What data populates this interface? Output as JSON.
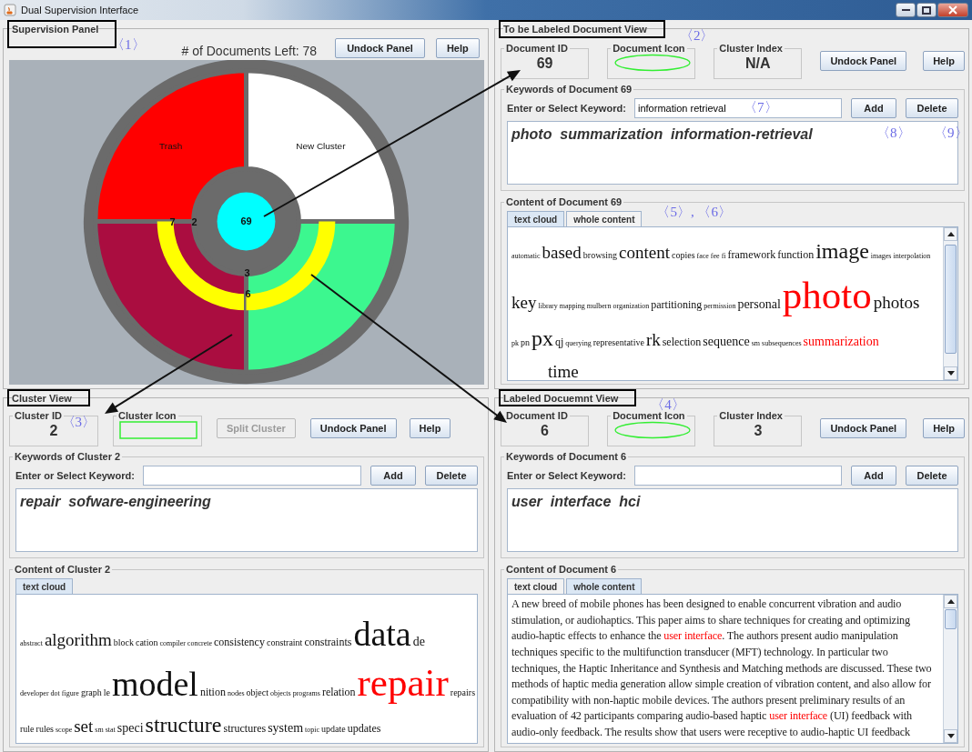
{
  "window": {
    "title": "Dual Supervision Interface"
  },
  "supervision_panel": {
    "title": "Supervision Panel",
    "marker": "〈1〉",
    "documents_left": "# of Documents Left: 78",
    "buttons": [
      "Undock Panel",
      "Help"
    ],
    "wheel": {
      "center_label": "69",
      "ring_labels": [
        "7",
        "2",
        "3",
        "6"
      ],
      "sectors": [
        {
          "label": "Trash",
          "color": "#ff0000"
        },
        {
          "label": "New Cluster",
          "color": "#ffffff"
        },
        {
          "color": "#aa0d40"
        },
        {
          "color": "#3cf78f"
        }
      ]
    }
  },
  "document_view": {
    "title": "To be Labeled Document View",
    "title_marker": "〈2〉",
    "info_boxes": [
      {
        "label": "Document ID",
        "kind": "value",
        "value": "69"
      },
      {
        "label": "Document Icon",
        "kind": "ellipse"
      },
      {
        "label": "Cluster Index",
        "kind": "value",
        "value": "N/A"
      }
    ],
    "buttons": [
      {
        "label": "Undock Panel",
        "disabled": false
      },
      {
        "label": "Help",
        "disabled": false
      }
    ],
    "keywords": {
      "title": "Keywords of Document 69",
      "prompt": "Enter or Select Keyword:",
      "input_value": "information retrieval",
      "input_marker": "〈7〉",
      "add": "Add",
      "delete": "Delete",
      "text": "photo  summarization  information-retrieval",
      "markers": [
        "〈8〉",
        "〈9〉"
      ]
    },
    "content": {
      "title": "Content of Document 69",
      "tabs_marker": "〈5〉, 〈6〉",
      "kind": "cloud",
      "scrollbar": true,
      "tabs": [
        {
          "label": "text cloud",
          "selected": true
        },
        {
          "label": "whole content",
          "selected": false
        }
      ],
      "lines": [
        [
          {
            "text": "automatic",
            "kind": "tiny",
            "highlighted": false
          },
          {
            "text": "based",
            "kind": "large",
            "highlighted": false
          },
          {
            "text": "browsing",
            "kind": "small",
            "highlighted": false
          },
          {
            "text": "content",
            "kind": "large",
            "highlighted": false
          },
          {
            "text": "copies",
            "kind": "small",
            "highlighted": false
          },
          {
            "text": "face",
            "kind": "tiny",
            "highlighted": false
          },
          {
            "text": "fee",
            "kind": "tiny",
            "highlighted": false
          },
          {
            "text": "fi",
            "kind": "tiny",
            "highlighted": false
          },
          {
            "text": "framework",
            "kind": "normal",
            "highlighted": false
          },
          {
            "text": "function",
            "kind": "normal",
            "highlighted": false
          },
          {
            "text": "image",
            "kind": "xlarge",
            "highlighted": false
          },
          {
            "text": "images",
            "kind": "tiny",
            "highlighted": false
          },
          {
            "text": "interpolation",
            "kind": "tiny",
            "highlighted": false
          }
        ],
        [
          {
            "text": "key",
            "kind": "large",
            "highlighted": false
          },
          {
            "text": "library",
            "kind": "tiny",
            "highlighted": false
          },
          {
            "text": "mapping",
            "kind": "tiny",
            "highlighted": false
          },
          {
            "text": "mulbern",
            "kind": "tiny",
            "highlighted": false
          },
          {
            "text": "organization",
            "kind": "tiny",
            "highlighted": false
          },
          {
            "text": "partitioning",
            "kind": "normal",
            "highlighted": false
          },
          {
            "text": "permission",
            "kind": "tiny",
            "highlighted": false
          },
          {
            "text": "personal",
            "kind": "medium",
            "highlighted": false
          },
          {
            "text": "photo",
            "kind": "giant",
            "highlighted": true
          },
          {
            "text": "photos",
            "kind": "large",
            "highlighted": false
          }
        ],
        [
          {
            "text": "pk",
            "kind": "tiny",
            "highlighted": false
          },
          {
            "text": "pn",
            "kind": "small",
            "highlighted": false
          },
          {
            "text": "px",
            "kind": "xlarge",
            "highlighted": false
          },
          {
            "text": "qj",
            "kind": "normal",
            "highlighted": false
          },
          {
            "text": "querying",
            "kind": "tiny",
            "highlighted": false
          },
          {
            "text": "representative",
            "kind": "small",
            "highlighted": false
          },
          {
            "text": "rk",
            "kind": "large",
            "highlighted": false
          },
          {
            "text": "selection",
            "kind": "normal",
            "highlighted": false
          },
          {
            "text": "sequence",
            "kind": "medium",
            "highlighted": false
          },
          {
            "text": "sm",
            "kind": "tiny",
            "highlighted": false
          },
          {
            "text": "subsequences",
            "kind": "tiny",
            "highlighted": false
          },
          {
            "text": "summarization",
            "kind": "medium",
            "highlighted": true
          }
        ],
        [
          {
            "text": "time",
            "kind": "large",
            "highlighted": false
          }
        ]
      ]
    }
  },
  "cluster_view": {
    "title": "Cluster View",
    "info_boxes": [
      {
        "label": "Cluster ID",
        "kind": "value",
        "value": "2",
        "marker": "〈3〉"
      },
      {
        "label": "Cluster Icon",
        "kind": "rect"
      }
    ],
    "buttons": [
      {
        "label": "Split Cluster",
        "disabled": true
      },
      {
        "label": "Undock Panel",
        "disabled": false
      },
      {
        "label": "Help",
        "disabled": false
      }
    ],
    "keywords": {
      "title": "Keywords of Cluster 2",
      "prompt": "Enter or Select Keyword:",
      "add": "Add",
      "delete": "Delete",
      "text": "repair  sofware-engineering"
    },
    "content": {
      "title": "Content of Cluster 2",
      "kind": "cloud",
      "scrollbar": false,
      "tabs": [
        {
          "label": "text cloud",
          "selected": true
        }
      ],
      "lines": [
        [
          {
            "text": "abstract",
            "kind": "tiny",
            "highlighted": false
          },
          {
            "text": "algorithm",
            "kind": "large",
            "highlighted": false
          },
          {
            "text": "block",
            "kind": "small",
            "highlighted": false
          },
          {
            "text": "cation",
            "kind": "small",
            "highlighted": false
          },
          {
            "text": "compiler",
            "kind": "tiny",
            "highlighted": false
          },
          {
            "text": "concrete",
            "kind": "tiny",
            "highlighted": false
          },
          {
            "text": "consistency",
            "kind": "normal",
            "highlighted": false
          },
          {
            "text": "constraint",
            "kind": "small",
            "highlighted": false
          },
          {
            "text": "constraints",
            "kind": "normal",
            "highlighted": false
          },
          {
            "text": "data",
            "kind": "huge",
            "highlighted": false
          },
          {
            "text": "de",
            "kind": "medium",
            "highlighted": false
          }
        ],
        [
          {
            "text": "developer",
            "kind": "tiny",
            "highlighted": false
          },
          {
            "text": "dot",
            "kind": "tiny",
            "highlighted": false
          },
          {
            "text": "figure",
            "kind": "tiny",
            "highlighted": false
          },
          {
            "text": "graph",
            "kind": "small",
            "highlighted": false
          },
          {
            "text": "le",
            "kind": "small",
            "highlighted": false
          },
          {
            "text": "model",
            "kind": "huge",
            "highlighted": false
          },
          {
            "text": "nition",
            "kind": "normal",
            "highlighted": false
          },
          {
            "text": "nodes",
            "kind": "tiny",
            "highlighted": false
          },
          {
            "text": "object",
            "kind": "small",
            "highlighted": false
          },
          {
            "text": "objects",
            "kind": "tiny",
            "highlighted": false
          },
          {
            "text": "programs",
            "kind": "tiny",
            "highlighted": false
          },
          {
            "text": "relation",
            "kind": "normal",
            "highlighted": false
          },
          {
            "text": "repair",
            "kind": "giant",
            "highlighted": true
          },
          {
            "text": "repairs",
            "kind": "small",
            "highlighted": false
          }
        ],
        [
          {
            "text": "rule",
            "kind": "small",
            "highlighted": false
          },
          {
            "text": "rules",
            "kind": "small",
            "highlighted": false
          },
          {
            "text": "scope",
            "kind": "tiny",
            "highlighted": false
          },
          {
            "text": "set",
            "kind": "large",
            "highlighted": false
          },
          {
            "text": "sm",
            "kind": "tiny",
            "highlighted": false
          },
          {
            "text": "stat",
            "kind": "tiny",
            "highlighted": false
          },
          {
            "text": "speci",
            "kind": "medium",
            "highlighted": false
          },
          {
            "text": "structure",
            "kind": "xlarge",
            "highlighted": false
          },
          {
            "text": "structures",
            "kind": "normal",
            "highlighted": false
          },
          {
            "text": "system",
            "kind": "medium",
            "highlighted": false
          },
          {
            "text": "topic",
            "kind": "tiny",
            "highlighted": false
          },
          {
            "text": "update",
            "kind": "small",
            "highlighted": false
          },
          {
            "text": "updates",
            "kind": "normal",
            "highlighted": false
          }
        ]
      ]
    }
  },
  "labeled_document_view": {
    "title": "Labeled Docuemnt View",
    "title_marker": "〈4〉",
    "info_boxes": [
      {
        "label": "Document ID",
        "kind": "value",
        "value": "6"
      },
      {
        "label": "Document Icon",
        "kind": "ellipse"
      },
      {
        "label": "Cluster Index",
        "kind": "value",
        "value": "3"
      }
    ],
    "buttons": [
      {
        "label": "Undock Panel",
        "disabled": false
      },
      {
        "label": "Help",
        "disabled": false
      }
    ],
    "keywords": {
      "title": "Keywords of Document 6",
      "prompt": "Enter or Select Keyword:",
      "add": "Add",
      "delete": "Delete",
      "text": "user  interface  hci"
    },
    "content": {
      "title": "Content of Document 6",
      "kind": "text",
      "scrollbar": true,
      "tabs": [
        {
          "label": "text cloud",
          "selected": false
        },
        {
          "label": "whole content",
          "selected": true
        }
      ],
      "segments": [
        {
          "text": "A new breed of mobile phones has been designed to enable concurrent vibration and audio stimulation, or audiohaptics. This paper aims to share techniques for creating and optimizing audio-haptic effects to enhance the ",
          "highlighted": false
        },
        {
          "text": "user interface",
          "highlighted": true
        },
        {
          "text": ". The authors present audio manipulation techniques specific to the multifunction transducer (MFT) technology. In particular two techniques, the Haptic Inheritance and Synthesis and Matching methods are discussed. These two methods of haptic media generation allow simple creation of vibration content, and also allow for compatibility with non-haptic mobile devices. The authors present preliminary results of an evaluation of 42 participants comparing audio-based haptic ",
          "highlighted": false
        },
        {
          "text": "user interface",
          "highlighted": true
        },
        {
          "text": " (UI) feedback with audio-only feedback. The results show that users were receptive to audio-haptic UI feedback",
          "highlighted": false
        }
      ]
    }
  }
}
